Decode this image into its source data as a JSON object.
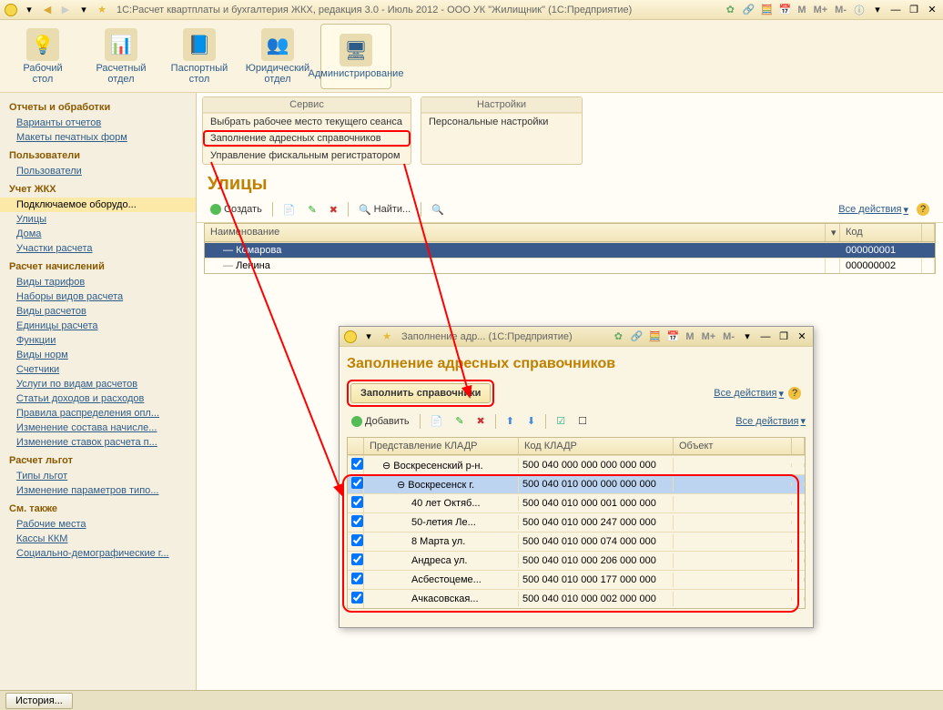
{
  "title": "1С:Расчет квартплаты и бухгалтерия ЖКХ, редакция 3.0 - Июль 2012 - ООО УК \"Жилищник\"  (1С:Предприятие)",
  "mainTabs": [
    {
      "id": "desktop",
      "l1": "Рабочий",
      "l2": "стол"
    },
    {
      "id": "calc-dept",
      "l1": "Расчетный",
      "l2": "отдел"
    },
    {
      "id": "passport",
      "l1": "Паспортный",
      "l2": "стол"
    },
    {
      "id": "legal",
      "l1": "Юридический",
      "l2": "отдел"
    },
    {
      "id": "admin",
      "l1": "Администрирование",
      "l2": ""
    }
  ],
  "sidebar": [
    {
      "h": "Отчеты и обработки",
      "items": [
        "Варианты отчетов",
        "Макеты печатных форм"
      ]
    },
    {
      "h": "Пользователи",
      "items": [
        "Пользователи"
      ]
    },
    {
      "h": "Учет ЖКХ",
      "items": [
        "Подключаемое оборудо...",
        "Улицы",
        "Дома",
        "Участки расчета"
      ],
      "sel": 0
    },
    {
      "h": "Расчет начислений",
      "items": [
        "Виды тарифов",
        "Наборы видов расчета",
        "Виды расчетов",
        "Единицы расчета",
        "Функции",
        "Виды норм",
        "Счетчики",
        "Услуги по видам расчетов",
        "Статьи доходов и расходов",
        "Правила распределения опл...",
        "Изменение состава начисле...",
        "Изменение ставок расчета п..."
      ]
    },
    {
      "h": "Расчет льгот",
      "items": [
        "Типы льгот",
        "Изменение параметров типо..."
      ]
    },
    {
      "h": "См. также",
      "items": [
        "Рабочие места",
        "Кассы ККМ",
        "Социально-демографические г..."
      ]
    }
  ],
  "panelService": {
    "h": "Сервис",
    "rows": [
      "Выбрать рабочее место текущего сеанса",
      "Заполнение адресных справочников",
      "Управление фискальным регистратором"
    ],
    "hl": 1
  },
  "panelSettings": {
    "h": "Настройки",
    "rows": [
      "Персональные настройки"
    ]
  },
  "page": {
    "title": "Улицы",
    "create": "Создать",
    "find": "Найти...",
    "allActions": "Все действия"
  },
  "grid": {
    "cols": [
      "Наименование",
      "Код"
    ],
    "rows": [
      {
        "name": "Комарова",
        "code": "000000001",
        "sel": true
      },
      {
        "name": "Ленина",
        "code": "000000002"
      }
    ]
  },
  "modal": {
    "title": "Заполнение адр...  (1С:Предприятие)",
    "heading": "Заполнение адресных справочников",
    "fillBtn": "Заполнить справочники",
    "allActions": "Все действия",
    "add": "Добавить",
    "cols": [
      "",
      "Представление КЛАДР",
      "Код КЛАДР",
      "Объект"
    ],
    "rows": [
      {
        "rep": "Воскресенский р-н.",
        "code": "500 040 000 000 000 000 000",
        "lvl": 0
      },
      {
        "rep": "Воскресенск г.",
        "code": "500 040 010 000 000 000 000",
        "lvl": 1,
        "sel": true
      },
      {
        "rep": "40 лет Октяб...",
        "code": "500 040 010 000 001 000 000",
        "lvl": 2
      },
      {
        "rep": "50-летия Ле...",
        "code": "500 040 010 000 247 000 000",
        "lvl": 2
      },
      {
        "rep": "8 Марта ул.",
        "code": "500 040 010 000 074 000 000",
        "lvl": 2
      },
      {
        "rep": "Андреса ул.",
        "code": "500 040 010 000 206 000 000",
        "lvl": 2
      },
      {
        "rep": "Асбестоцеме...",
        "code": "500 040 010 000 177 000 000",
        "lvl": 2
      },
      {
        "rep": "Ачкасовская...",
        "code": "500 040 010 000 002 000 000",
        "lvl": 2
      }
    ]
  },
  "status": {
    "history": "История..."
  }
}
